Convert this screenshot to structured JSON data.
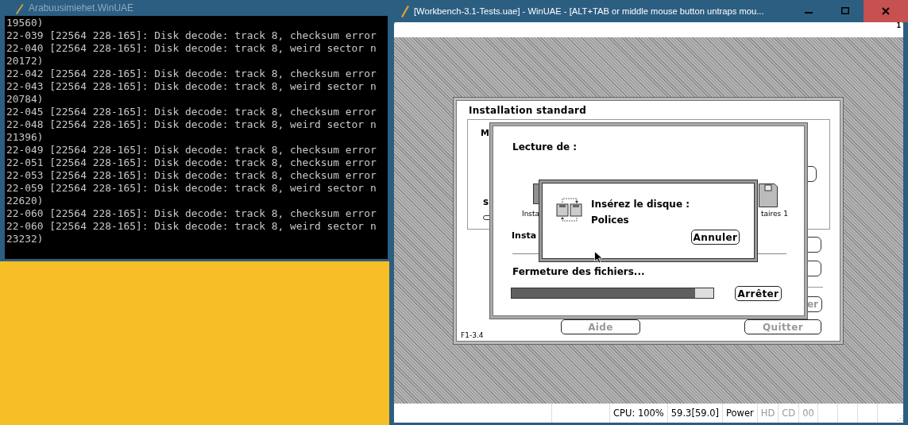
{
  "console_window": {
    "title": "Arabuusimiehet.WinUAE",
    "lines": [
      "19560)",
      "22-039 [22564 228-165]: Disk decode: track 8, checksum error",
      "22-040 [22564 228-165]: Disk decode: track 8, weird sector n",
      "20172)",
      "22-042 [22564 228-165]: Disk decode: track 8, checksum error",
      "22-043 [22564 228-165]: Disk decode: track 8, weird sector n",
      "20784)",
      "22-045 [22564 228-165]: Disk decode: track 8, checksum error",
      "22-048 [22564 228-165]: Disk decode: track 8, weird sector n",
      "21396)",
      "22-049 [22564 228-165]: Disk decode: track 8, checksum error",
      "22-051 [22564 228-165]: Disk decode: track 8, checksum error",
      "22-053 [22564 228-165]: Disk decode: track 8, checksum error",
      "22-059 [22564 228-165]: Disk decode: track 8, weird sector n",
      "22620)",
      "22-060 [22564 228-165]: Disk decode: track 8, checksum error",
      "22-060 [22564 228-165]: Disk decode: track 8, weird sector n",
      "23232)"
    ]
  },
  "emulator_window": {
    "title": "[Workbench-3.1-Tests.uae] - WinUAE - [ALT+TAB or middle mouse button untraps mou...",
    "menu_bar": {
      "number": "1"
    },
    "installer": {
      "title": "Installation standard",
      "fragment_top": "M",
      "fragment_side": "s",
      "section_label": "Insta",
      "partial_button": "er",
      "buttons": [
        {
          "label": "Aide",
          "disabled": true
        },
        {
          "label": "Quitter",
          "disabled": true
        }
      ],
      "version": "F1-3.4"
    },
    "progress_dialog": {
      "heading": "Lecture de :",
      "icon_labels": [
        "Insta",
        "taires 1"
      ],
      "status": "Fermeture des fichiers...",
      "level": 0.91,
      "button": "Arrêter"
    },
    "insert_dialog": {
      "message": "Insérez le disque :",
      "disk": "Polices",
      "button": "Annuler"
    },
    "status_bar": [
      {
        "text": "CPU: 100%",
        "on": true
      },
      {
        "text": "59.3[59.0]",
        "on": true
      },
      {
        "text": "Power",
        "on": true
      },
      {
        "text": "HD",
        "on": false
      },
      {
        "text": "CD",
        "on": false
      },
      {
        "text": "00",
        "on": false
      }
    ]
  }
}
